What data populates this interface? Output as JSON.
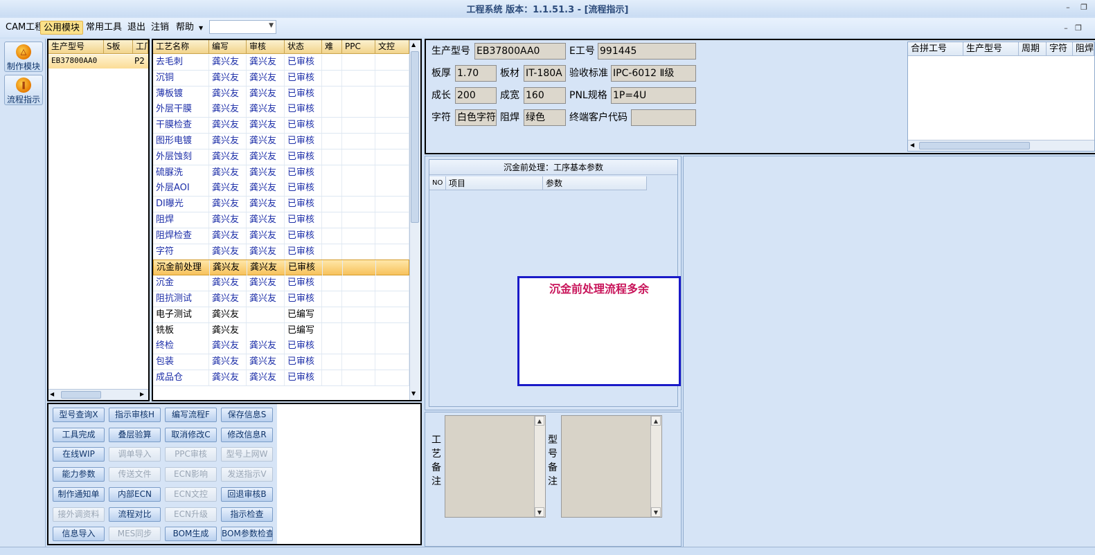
{
  "window": {
    "title": "工程系统   版本：1.1.51.3 - [流程指示]"
  },
  "menu": {
    "items": [
      "CAM工程",
      "公用模块",
      "常用工具",
      "退出",
      "注销",
      "帮助"
    ],
    "active": "公用模块",
    "combo_value": ""
  },
  "leftbar": {
    "buttons": [
      "制作模块",
      "流程指示"
    ]
  },
  "model_list": {
    "headers": [
      "生产型号",
      "S板",
      "工厂"
    ],
    "rows": [
      {
        "model": "EB37800AA0",
        "s": "",
        "factory": "P2"
      }
    ]
  },
  "process_list": {
    "headers": [
      "工艺名称",
      "编写",
      "审核",
      "状态",
      "难",
      "PPC",
      "文控"
    ],
    "rows": [
      {
        "name": "去毛刺",
        "writer": "龚兴友",
        "reviewer": "龚兴友",
        "status": "已审核"
      },
      {
        "name": "沉铜",
        "writer": "龚兴友",
        "reviewer": "龚兴友",
        "status": "已审核"
      },
      {
        "name": "薄板镀",
        "writer": "龚兴友",
        "reviewer": "龚兴友",
        "status": "已审核"
      },
      {
        "name": "外层干膜",
        "writer": "龚兴友",
        "reviewer": "龚兴友",
        "status": "已审核"
      },
      {
        "name": "干膜检查",
        "writer": "龚兴友",
        "reviewer": "龚兴友",
        "status": "已审核"
      },
      {
        "name": "图形电镀",
        "writer": "龚兴友",
        "reviewer": "龚兴友",
        "status": "已审核"
      },
      {
        "name": "外层蚀刻",
        "writer": "龚兴友",
        "reviewer": "龚兴友",
        "status": "已审核"
      },
      {
        "name": "硫脲洗",
        "writer": "龚兴友",
        "reviewer": "龚兴友",
        "status": "已审核"
      },
      {
        "name": "外层AOI",
        "writer": "龚兴友",
        "reviewer": "龚兴友",
        "status": "已审核"
      },
      {
        "name": "DI曝光",
        "writer": "龚兴友",
        "reviewer": "龚兴友",
        "status": "已审核"
      },
      {
        "name": "阻焊",
        "writer": "龚兴友",
        "reviewer": "龚兴友",
        "status": "已审核"
      },
      {
        "name": "阻焊检查",
        "writer": "龚兴友",
        "reviewer": "龚兴友",
        "status": "已审核"
      },
      {
        "name": "字符",
        "writer": "龚兴友",
        "reviewer": "龚兴友",
        "status": "已审核"
      },
      {
        "name": "沉金前处理",
        "writer": "龚兴友",
        "reviewer": "龚兴友",
        "status": "已审核",
        "selected": true
      },
      {
        "name": "沉金",
        "writer": "龚兴友",
        "reviewer": "龚兴友",
        "status": "已审核"
      },
      {
        "name": "阻抗测试",
        "writer": "龚兴友",
        "reviewer": "龚兴友",
        "status": "已审核"
      },
      {
        "name": "电子测试",
        "writer": "龚兴友",
        "reviewer": "",
        "status": "已编写"
      },
      {
        "name": "铣板",
        "writer": "龚兴友",
        "reviewer": "",
        "status": "已编写"
      },
      {
        "name": "终检",
        "writer": "龚兴友",
        "reviewer": "龚兴友",
        "status": "已审核"
      },
      {
        "name": "包装",
        "writer": "龚兴友",
        "reviewer": "龚兴友",
        "status": "已审核"
      },
      {
        "name": "成品仓",
        "writer": "龚兴友",
        "reviewer": "龚兴友",
        "status": "已审核"
      }
    ]
  },
  "actions": [
    {
      "label": "型号查询X",
      "enabled": true
    },
    {
      "label": "指示审核H",
      "enabled": true
    },
    {
      "label": "编写流程F",
      "enabled": true
    },
    {
      "label": "保存信息S",
      "enabled": true
    },
    {
      "label": "工具完成",
      "enabled": true
    },
    {
      "label": "叠层验算",
      "enabled": true
    },
    {
      "label": "取消修改C",
      "enabled": true
    },
    {
      "label": "修改信息R",
      "enabled": true
    },
    {
      "label": "在线WIP",
      "enabled": true
    },
    {
      "label": "调单导入",
      "enabled": false
    },
    {
      "label": "PPC审核",
      "enabled": false
    },
    {
      "label": "型号上网W",
      "enabled": false
    },
    {
      "label": "能力参数",
      "enabled": true
    },
    {
      "label": "传送文件",
      "enabled": false
    },
    {
      "label": "ECN影响",
      "enabled": false
    },
    {
      "label": "发送指示V",
      "enabled": false
    },
    {
      "label": "制作通知单",
      "enabled": true
    },
    {
      "label": "内部ECN",
      "enabled": true
    },
    {
      "label": "ECN文控",
      "enabled": false
    },
    {
      "label": "回退审核B",
      "enabled": true
    },
    {
      "label": "接外调资料",
      "enabled": false
    },
    {
      "label": "流程对比",
      "enabled": true
    },
    {
      "label": "ECN升级",
      "enabled": false
    },
    {
      "label": "指示检查",
      "enabled": true
    },
    {
      "label": "信息导入",
      "enabled": true
    },
    {
      "label": "MES同步",
      "enabled": false
    },
    {
      "label": "BOM生成",
      "enabled": true
    },
    {
      "label": "BOM参数检查",
      "enabled": true
    }
  ],
  "info": {
    "model_label": "生产型号",
    "model_value": "EB37800AA0",
    "e_label": "E工号",
    "e_value": "991445",
    "thickness_label": "板厚",
    "thickness_value": "1.70",
    "material_label": "板材",
    "material_value": "IT-180A",
    "standard_label": "验收标准",
    "standard_value": "IPC-6012 Ⅱ级",
    "length_label": "成长",
    "length_value": "200",
    "width_label": "成宽",
    "width_value": "160",
    "pnl_label": "PNL规格",
    "pnl_value": "1P=4U",
    "char_label": "字符",
    "char_value": "白色字符",
    "mask_label": "阻焊",
    "mask_value": "绿色",
    "customer_label": "终端客户代码",
    "customer_value": ""
  },
  "merge_grid": {
    "headers": [
      "合拼工号",
      "生产型号",
      "周期",
      "字符",
      "阻焊"
    ]
  },
  "params": {
    "title": "沉金前处理：工序基本参数",
    "headers": [
      "NO",
      "项目",
      "参数"
    ],
    "alert": "沉金前处理流程多余"
  },
  "notes": {
    "process_label": "工艺备注",
    "model_label": "型号备注",
    "process_text": "",
    "model_text": ""
  }
}
